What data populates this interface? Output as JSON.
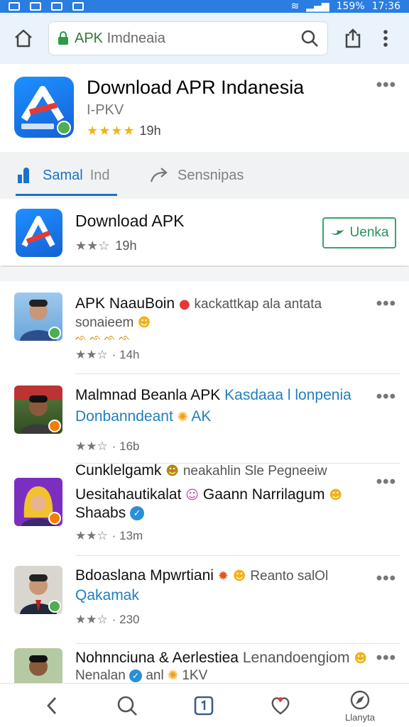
{
  "status_bar": {
    "battery": "159%",
    "time": "17:36"
  },
  "browser": {
    "url_host": "APK",
    "url_rest": " Imdneaia"
  },
  "app": {
    "title": "Download APR Indanesia",
    "subtitle": "I-PKV",
    "stars": "★★★★",
    "rating_text": "19h"
  },
  "tabs": [
    {
      "label": "Samal",
      "extra": "Ind"
    },
    {
      "label": "Sensnipas"
    }
  ],
  "download_card": {
    "title": "Download APK",
    "stars": "★★☆",
    "rating_text": "19h",
    "button_label": "Uenka"
  },
  "list": [
    {
      "line1": "APK NaauBoin",
      "line1_extra": "kackattkap ala antata",
      "line2": "sonaieem",
      "line3": "ᨒ ᨒ ᨒ ᨒ",
      "stars": "★★☆",
      "meta": "· 14h"
    },
    {
      "line1": "Malmnad Beanla APK",
      "line1_extra": "Kasdaaa l lonpenia",
      "line2": "Donbanndeant",
      "line2_extra": "AK",
      "stars": "★★☆",
      "meta": "· 16b"
    },
    {
      "line0": "Cunklelgamk",
      "line0_extra": "neakahlin Sle Pegneeiw",
      "line1": "Uesitahautikalat",
      "line1_extra": "Gaann Narrilagum",
      "line2": "Shaabs",
      "stars": "★★☆",
      "meta": "· 13m"
    },
    {
      "line1": "Bdoaslana Mpwrtiani",
      "line1_extra": "Reanto salOl",
      "line2": "Qakamak",
      "stars": "★★☆",
      "meta": "· 230"
    },
    {
      "line1": "Nohnnciuna & Aerlestiea",
      "line1_extra": "Lenandoengiom",
      "line2": "Nenalan",
      "line2_extra": "anl",
      "line2_extra2": "1KV"
    }
  ],
  "bottom_nav": {
    "last_label": "Llanyta"
  },
  "colors": {
    "accent": "#1a73c7",
    "status_bar": "#2a7de1",
    "install": "#37a36c",
    "star": "#f2b21b"
  }
}
